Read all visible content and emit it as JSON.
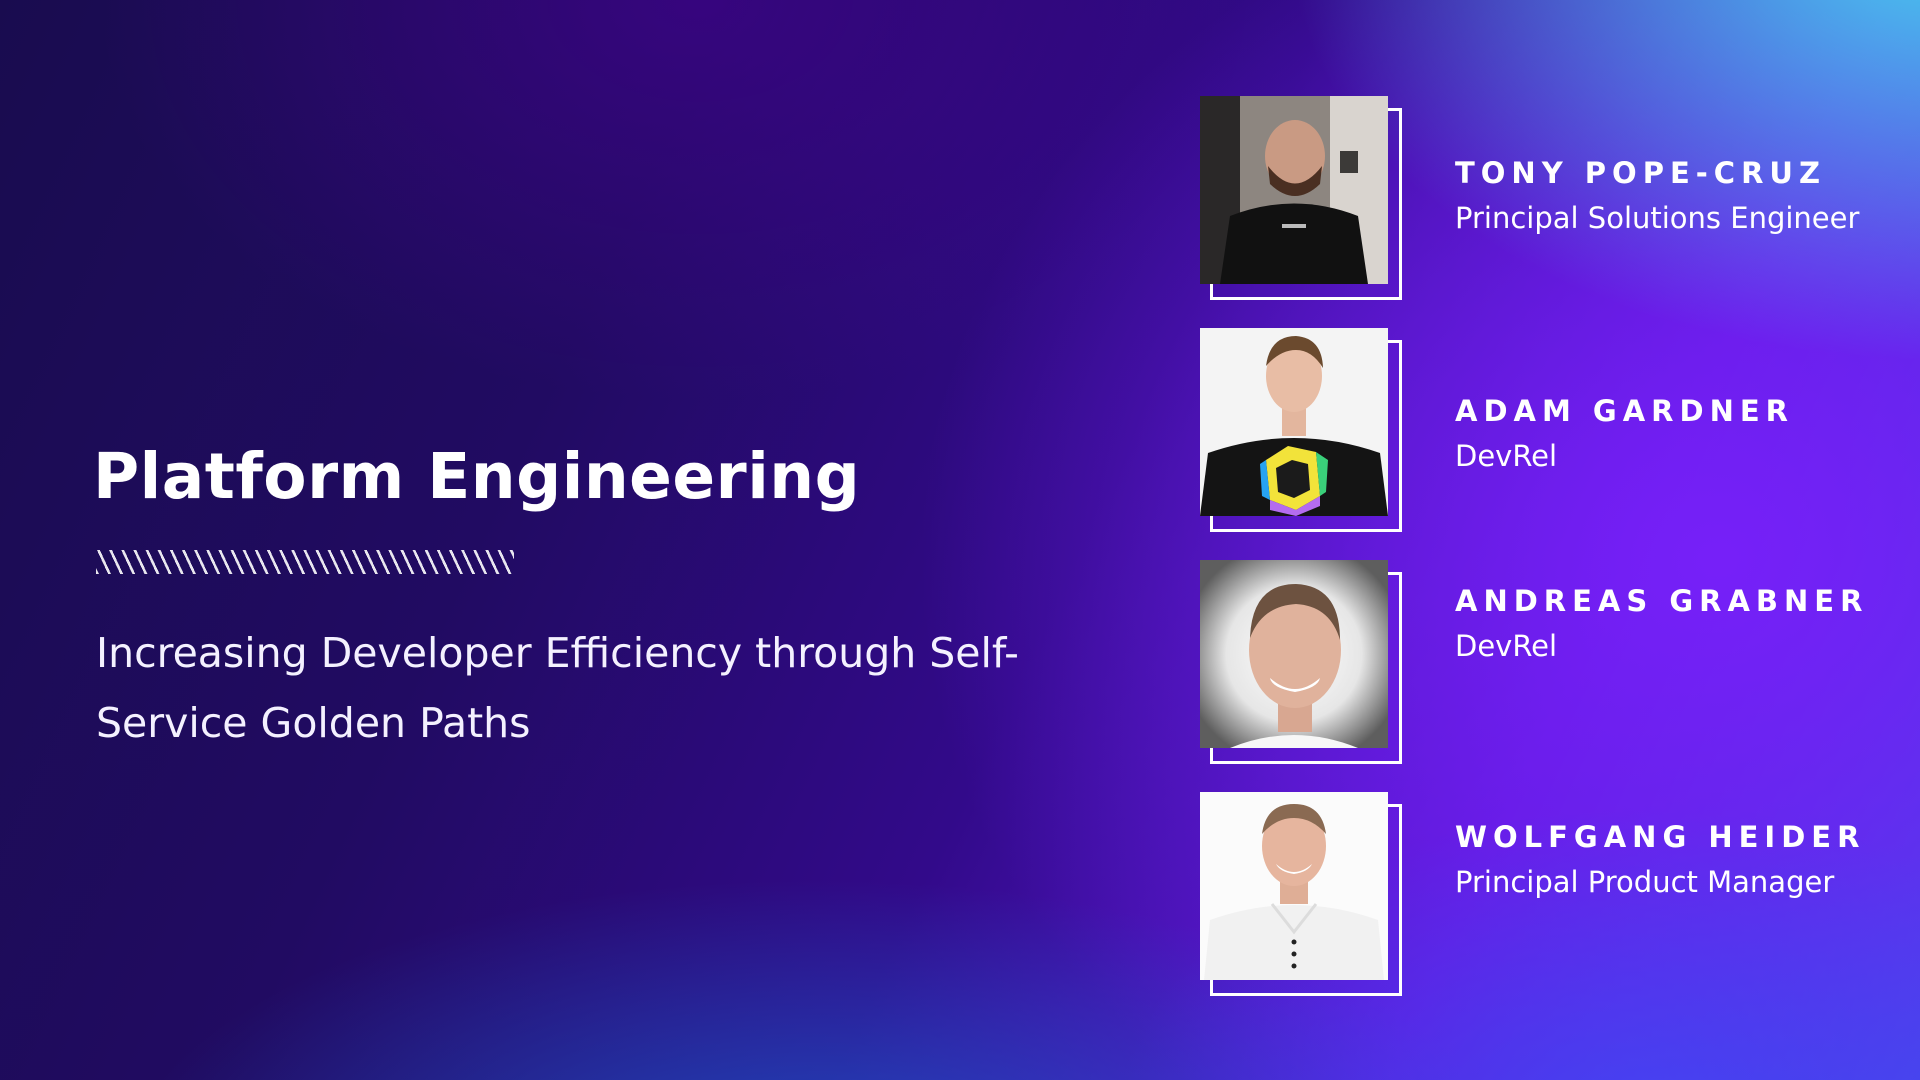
{
  "slide": {
    "title": "Platform Engineering",
    "subtitle": "Increasing Developer Efficiency through Self-Service Golden Paths"
  },
  "speakers": [
    {
      "name": "Tony Pope-Cruz",
      "role": "Principal Solutions Engineer"
    },
    {
      "name": "Adam Gardner",
      "role": "DevRel"
    },
    {
      "name": "Andreas Grabner",
      "role": "DevRel"
    },
    {
      "name": "Wolfgang Heider",
      "role": "Principal Product Manager"
    }
  ],
  "colors": {
    "text": "#ffffff",
    "frame": "#ffffff",
    "background_dark": "#1a0c52",
    "background_purple": "#7a20fa",
    "background_cyan": "#46d7f0"
  }
}
